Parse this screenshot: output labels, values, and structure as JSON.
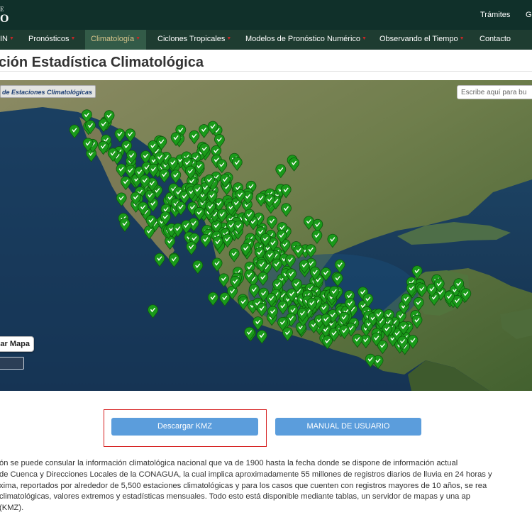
{
  "header": {
    "logo_line1": "E",
    "logo_line2": "O",
    "links": {
      "tramites": "Trámites",
      "gobierno": "Go"
    }
  },
  "nav": {
    "items": [
      {
        "label": "IN",
        "caret": true
      },
      {
        "label": "Pronósticos",
        "caret": true
      },
      {
        "label": "Climatología",
        "caret": true,
        "active": true
      },
      {
        "label": "Ciclones Tropicales",
        "caret": true
      },
      {
        "label": "Modelos de Pronóstico Numérico",
        "caret": true
      },
      {
        "label": "Observando el Tiempo",
        "caret": true
      },
      {
        "label": "Contacto",
        "caret": false
      }
    ]
  },
  "page": {
    "title": "ción Estadística Climatológica"
  },
  "map": {
    "layer_label": "de Estaciones Climatológicas",
    "search_placeholder": "Escribe aquí para bu",
    "button_label": "ar Mapa",
    "station_icon": "check-marker-icon",
    "marker_color": "#1a9a1a"
  },
  "actions": {
    "download_kmz": "Descargar KMZ",
    "manual": "MANUAL DE USUARIO"
  },
  "description": {
    "lines": [
      "ón se puede consular la información climatológica nacional que va de 1900 hasta la fecha donde se dispone de información actual",
      "de Cuenca y Direcciones Locales de la CONAGUA, la cual implica aproximadamente 55 millones de registros diarios de lluvia en 24 horas y",
      "xima, reportados por alrededor de 5,500 estaciones climatológicas y para los casos que cuenten con registros mayores de 10 años, se rea",
      "climatológicas, valores extremos y estadísticas mensuales. Todo esto está disponible mediante tablas, un servidor de mapas y una ap",
      "(KMZ)."
    ]
  },
  "colors": {
    "header_bg": "#10302a",
    "nav_bg": "#1e3c31",
    "nav_active_text": "#d6c48b",
    "caret": "#c62626",
    "button_bg": "#5b9ddc",
    "highlight_border": "#d62020"
  }
}
